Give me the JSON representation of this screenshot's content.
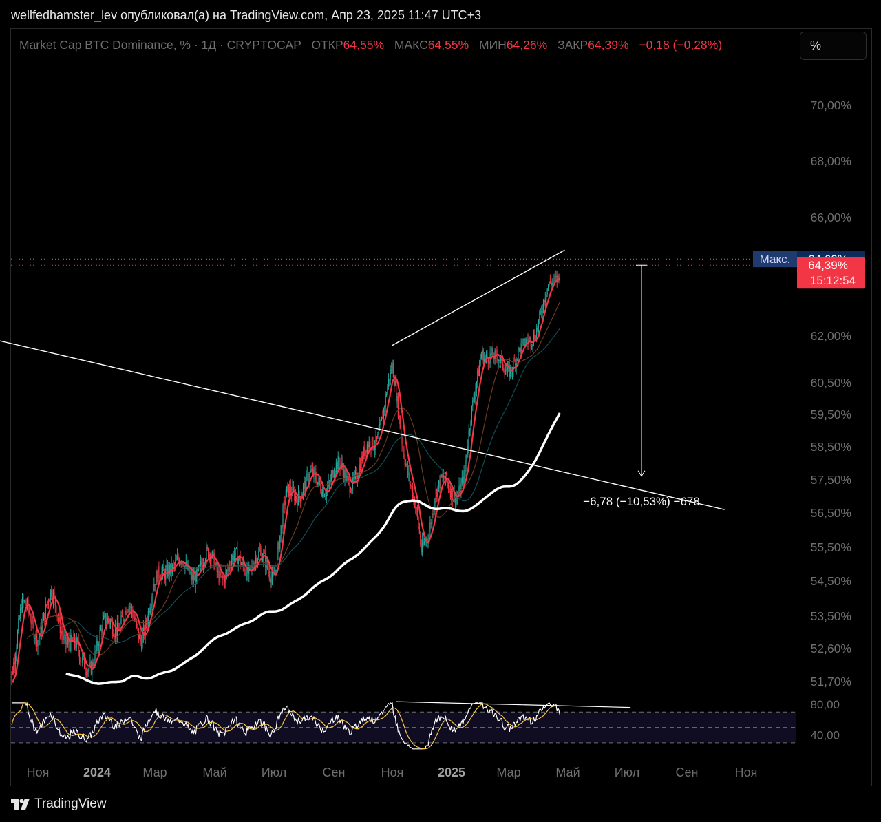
{
  "publish_line": "wellfedhamster_lev опубликовал(а) на TradingView.com, Апр 23, 2025 11:47 UTC+3",
  "legend": {
    "symbol": "Market Cap BTC Dominance, % · 1Д · CRYPTOCAP",
    "open_label": "ОТКР",
    "open_value": "64,55%",
    "high_label": "МАКС",
    "high_value": "64,55%",
    "low_label": "МИН",
    "low_value": "64,26%",
    "close_label": "ЗАКР",
    "close_value": "64,39%",
    "change": "−0,18 (−0,28%)"
  },
  "scale_button": "%",
  "price_labels": {
    "max_tag": "Макс.",
    "max_value": "64,60%",
    "last_value": "64,39%",
    "countdown": "15:12:54"
  },
  "measure_label": "−6,78 (−10,53%) −678",
  "footer_brand": "TradingView",
  "colors": {
    "up": "#26a69a",
    "down": "#f23645",
    "ma_fast": "#f23645",
    "ma_200": "#ffffff",
    "rsi": "#ffffff",
    "rsi_ma": "#f7c948",
    "price_tag": "#f23645",
    "max_tag": "#1e3a6e"
  },
  "chart_data": {
    "type": "line",
    "series_kind": "candlestick",
    "timeframe": "1D",
    "y_axis_ticks": [
      "70,00%",
      "68,00%",
      "66,00%",
      "62,00%",
      "60,50%",
      "59,50%",
      "58,50%",
      "57,50%",
      "56,50%",
      "55,50%",
      "54,50%",
      "53,50%",
      "52,60%",
      "51,70%"
    ],
    "x_axis_ticks": [
      "Ноя",
      "2024",
      "Мар",
      "Май",
      "Июл",
      "Сен",
      "Ноя",
      "2025",
      "Мар",
      "Май",
      "Июл",
      "Сен",
      "Ноя"
    ],
    "bold_x_ticks": [
      "2024",
      "2025"
    ],
    "ylim": [
      51.2,
      71.0
    ],
    "price_series": {
      "x": [
        "2023-10-01",
        "2023-10-15",
        "2023-11-01",
        "2023-11-15",
        "2023-12-01",
        "2023-12-15",
        "2024-01-01",
        "2024-01-15",
        "2024-02-01",
        "2024-02-15",
        "2024-03-01",
        "2024-03-15",
        "2024-04-01",
        "2024-04-15",
        "2024-05-01",
        "2024-05-15",
        "2024-06-01",
        "2024-06-15",
        "2024-07-01",
        "2024-07-15",
        "2024-08-01",
        "2024-08-15",
        "2024-09-01",
        "2024-09-15",
        "2024-10-01",
        "2024-10-15",
        "2024-11-01",
        "2024-11-15",
        "2024-12-01",
        "2024-12-15",
        "2025-01-01",
        "2025-01-15",
        "2025-02-01",
        "2025-02-15",
        "2025-03-01",
        "2025-03-15",
        "2025-04-01",
        "2025-04-15",
        "2025-04-23"
      ],
      "close": [
        51.7,
        53.6,
        53.2,
        53.9,
        53.0,
        52.1,
        52.6,
        53.4,
        53.5,
        53.1,
        54.2,
        55.2,
        54.7,
        55.0,
        55.0,
        54.8,
        55.1,
        55.0,
        54.9,
        56.8,
        57.5,
        57.3,
        57.7,
        57.6,
        57.9,
        58.9,
        60.7,
        58.3,
        55.2,
        57.2,
        57.2,
        57.6,
        61.8,
        61.0,
        61.2,
        61.3,
        62.7,
        63.6,
        64.39
      ]
    },
    "indicators": [
      "MA fast (red)",
      "MA mid (brown)",
      "MA slow (teal)",
      "MA 200 (white)"
    ],
    "max_marker": 64.6,
    "last_price": 64.39,
    "trendlines": [
      {
        "name": "descending resistance",
        "from": [
          "2023-09-01",
          62.0
        ],
        "to": [
          "2025-10-10",
          56.6
        ]
      },
      {
        "name": "rising wedge top",
        "from": [
          "2024-11-01",
          61.7
        ],
        "to": [
          "2025-04-28",
          64.9
        ]
      }
    ],
    "measure": {
      "from": 64.39,
      "to": 57.61,
      "change": -6.78,
      "change_pct": -10.53
    },
    "rsi_panel": {
      "ticks": [
        "80,00",
        "40,00"
      ],
      "band_upper": 70,
      "band_lower": 30,
      "divergence_line": {
        "from": [
          "2024-11-05",
          80.0
        ],
        "to": [
          "2025-07-05",
          76.0
        ]
      }
    }
  }
}
